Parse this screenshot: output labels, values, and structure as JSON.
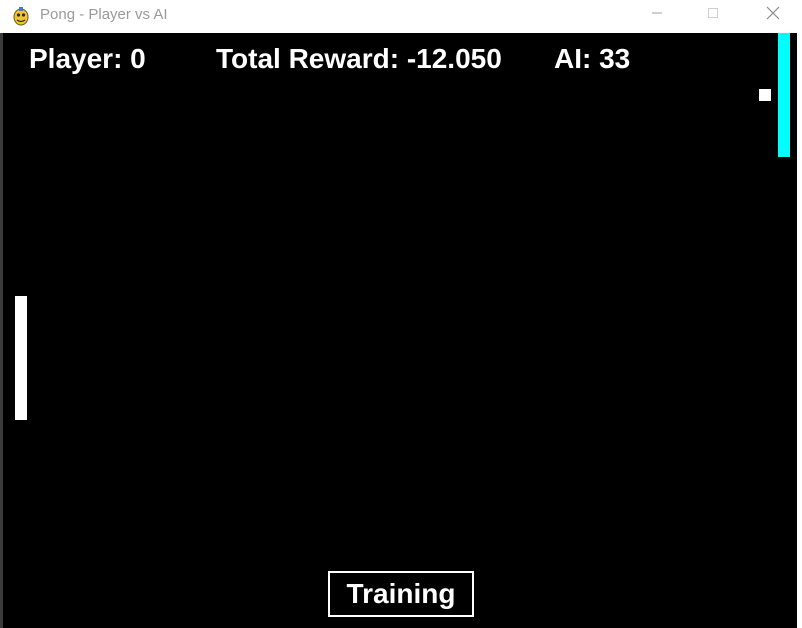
{
  "window": {
    "title": "Pong - Player vs AI",
    "icons": {
      "app": "pygame-snake-icon",
      "minimize": "minimize-icon",
      "maximize": "maximize-icon",
      "close": "close-icon"
    }
  },
  "hud": {
    "player_score": "Player: 0",
    "total_reward": "Total Reward: -12.050",
    "ai_score": "AI: 33"
  },
  "mode_button": {
    "label": "Training"
  },
  "colors": {
    "background": "#000000",
    "text": "#ffffff",
    "player_paddle": "#ffffff",
    "ai_paddle": "#00ffff",
    "ball": "#ffffff"
  }
}
